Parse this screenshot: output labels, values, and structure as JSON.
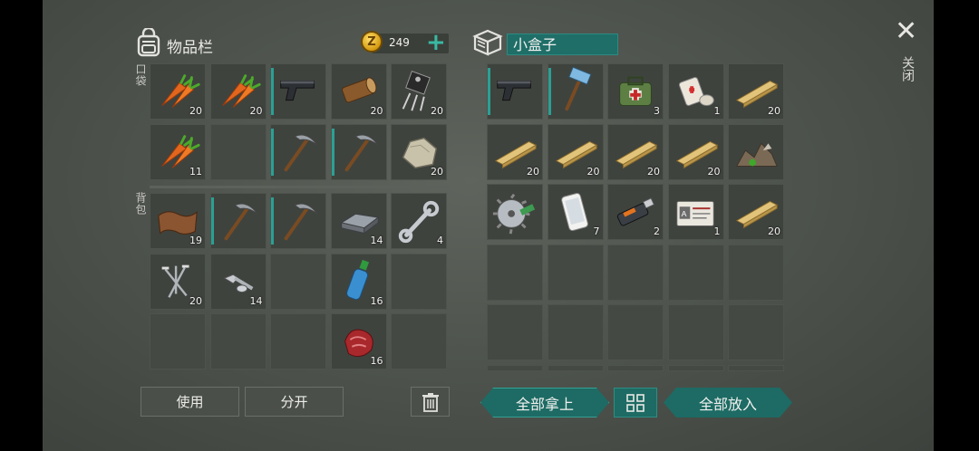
{
  "left_panel": {
    "title": "物品栏",
    "icon": "backpack-icon",
    "coins": "249",
    "coin_symbol": "Z",
    "pocket_label": "口袋",
    "backpack_label": "背包",
    "pockets": [
      {
        "item": "carrot",
        "count": "20"
      },
      {
        "item": "carrot",
        "count": "20"
      },
      {
        "item": "pistol",
        "count": "",
        "durability": true
      },
      {
        "item": "log",
        "count": "20"
      },
      {
        "item": "transistor",
        "count": "20"
      },
      {
        "item": "carrot",
        "count": "11"
      },
      {
        "item": "empty",
        "count": ""
      },
      {
        "item": "pickaxe",
        "count": "",
        "durability": true
      },
      {
        "item": "pickaxe",
        "count": "",
        "durability": true
      },
      {
        "item": "stone",
        "count": "20"
      }
    ],
    "backpack": [
      {
        "item": "leather",
        "count": "19"
      },
      {
        "item": "pickaxe",
        "count": "",
        "durability": true
      },
      {
        "item": "pickaxe",
        "count": "",
        "durability": true
      },
      {
        "item": "iron-bar",
        "count": "14"
      },
      {
        "item": "wrench",
        "count": "4"
      },
      {
        "item": "nails",
        "count": "20"
      },
      {
        "item": "bolts",
        "count": "14"
      },
      {
        "item": "empty",
        "count": ""
      },
      {
        "item": "water-bottle",
        "count": "16"
      },
      {
        "item": "empty",
        "count": ""
      },
      {
        "item": "empty",
        "count": ""
      },
      {
        "item": "empty",
        "count": ""
      },
      {
        "item": "empty",
        "count": ""
      },
      {
        "item": "raw-meat",
        "count": "16"
      },
      {
        "item": "empty",
        "count": ""
      }
    ],
    "use_button": "使用",
    "split_button": "分开"
  },
  "right_panel": {
    "title": "小盒子",
    "icon": "box-icon",
    "items": [
      {
        "item": "pistol",
        "count": "",
        "durability": true
      },
      {
        "item": "hammer",
        "count": "",
        "durability": true
      },
      {
        "item": "medkit",
        "count": "3"
      },
      {
        "item": "bandage",
        "count": "1"
      },
      {
        "item": "plank",
        "count": "20"
      },
      {
        "item": "plank",
        "count": "20"
      },
      {
        "item": "plank",
        "count": "20"
      },
      {
        "item": "plank",
        "count": "20"
      },
      {
        "item": "plank",
        "count": "20"
      },
      {
        "item": "scrap-pile",
        "count": ""
      },
      {
        "item": "saw-blade",
        "count": ""
      },
      {
        "item": "smartphone",
        "count": "7"
      },
      {
        "item": "usb-drive",
        "count": "2"
      },
      {
        "item": "id-card",
        "count": "1"
      },
      {
        "item": "plank",
        "count": "20"
      }
    ],
    "empty_rows": 3,
    "take_all_button": "全部拿上",
    "put_all_button": "全部放入",
    "sort_icon": "grid-sort-icon"
  },
  "close": {
    "label": "关闭",
    "icon": "close-icon"
  },
  "colors": {
    "teal": "#1d6b64",
    "slot": "#3f433e",
    "durability": "#2aa094"
  }
}
